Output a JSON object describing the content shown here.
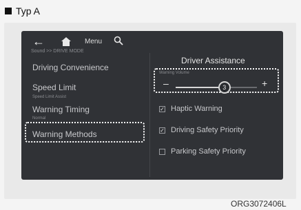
{
  "legend": {
    "label": "Typ A"
  },
  "topbar": {
    "menu_label": "Menu"
  },
  "left_menu": {
    "breadcrumb": "Sound >> DRIVE MODE",
    "items": [
      {
        "label": "Driving Convenience",
        "sub": ""
      },
      {
        "label": "Speed Limit",
        "sub": "Speed Limit Assist"
      },
      {
        "label": "Warning Timing",
        "sub": "Normal"
      },
      {
        "label": "Warning Methods",
        "sub": ""
      }
    ],
    "selected_item": "Warning Methods"
  },
  "panel": {
    "title": "Driver Assistance",
    "volume": {
      "label": "Warning Volume",
      "value": 3,
      "max": 5
    },
    "options": [
      {
        "label": "Haptic Warning",
        "checked": true
      },
      {
        "label": "Driving Safety Priority",
        "checked": true
      },
      {
        "label": "Parking Safety Priority",
        "checked": false
      }
    ]
  },
  "figure_code": "ORG3072406L"
}
